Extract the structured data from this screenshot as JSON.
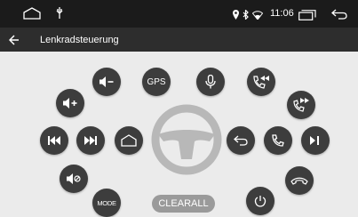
{
  "status_bar": {
    "time": "11:06",
    "icons": [
      "home-outline-icon",
      "usb-icon",
      "location-icon",
      "bluetooth-icon",
      "wifi-icon",
      "recent-apps-icon",
      "back-icon"
    ]
  },
  "header": {
    "title": "Lenkradsteuerung",
    "back_icon": "arrow-left-icon"
  },
  "buttons": {
    "gps_label": "GPS",
    "mode_label": "MODE",
    "clear_all_label": "CLEARALL"
  },
  "controls": [
    {
      "name": "volume-down",
      "icon": "speaker-minus-icon"
    },
    {
      "name": "gps",
      "icon": "text"
    },
    {
      "name": "voice",
      "icon": "microphone-icon"
    },
    {
      "name": "call-prev",
      "icon": "phone-prev-icon"
    },
    {
      "name": "volume-up",
      "icon": "speaker-plus-icon"
    },
    {
      "name": "call-next",
      "icon": "phone-next-icon"
    },
    {
      "name": "previous-track",
      "icon": "skip-back-icon"
    },
    {
      "name": "next-track",
      "icon": "skip-forward-icon"
    },
    {
      "name": "home",
      "icon": "home-icon"
    },
    {
      "name": "back",
      "icon": "return-icon"
    },
    {
      "name": "answer-call",
      "icon": "phone-icon"
    },
    {
      "name": "play-pause",
      "icon": "play-pause-icon"
    },
    {
      "name": "mute",
      "icon": "speaker-mute-icon"
    },
    {
      "name": "hang-up",
      "icon": "phone-hangup-icon"
    },
    {
      "name": "mode",
      "icon": "text"
    },
    {
      "name": "power",
      "icon": "power-icon"
    }
  ],
  "colors": {
    "background": "#ebebeb",
    "button": "#3d3d3d",
    "wheel": "#b8b8b8",
    "clear_button": "#9a9a9a",
    "status_bar": "#1b1b1b",
    "title_bar": "#2d2d2d"
  }
}
